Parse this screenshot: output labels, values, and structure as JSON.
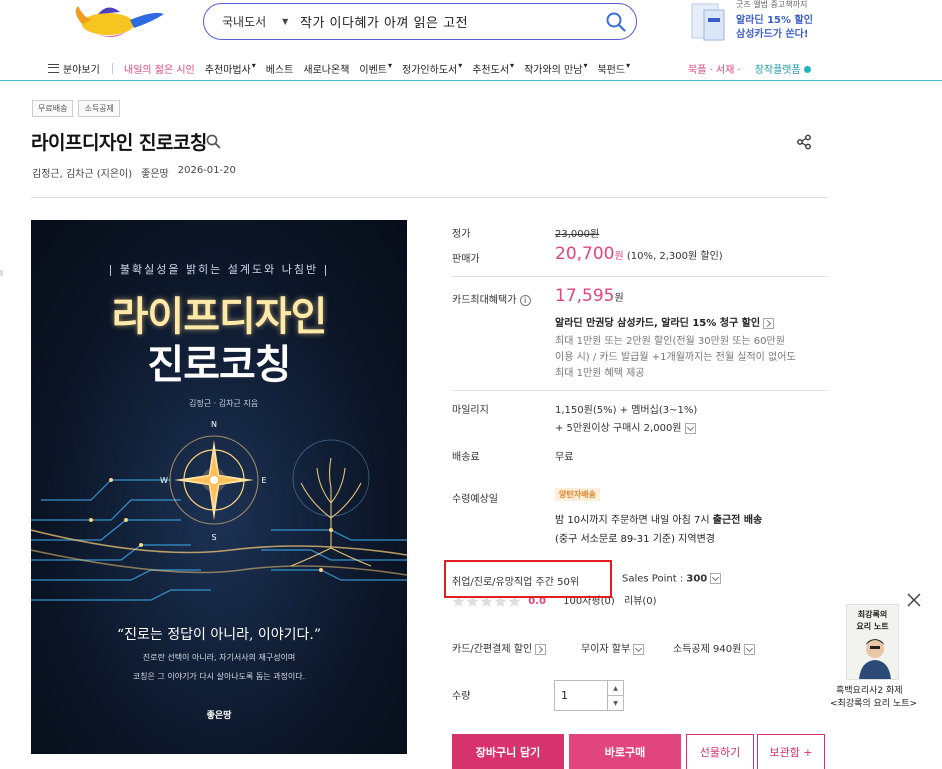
{
  "header": {
    "search": {
      "category": "국내도서",
      "query": "작가 이다혜가 아껴 읽은 고전"
    },
    "top_ad": {
      "line1": "굿즈 앨범 중고책까지",
      "line2": "알라딘 15% 할인",
      "line3": "삼성카드가 쏜다!"
    }
  },
  "gnb": {
    "menu_label": "분야보기",
    "items": [
      "내일의 젊은 시인",
      "추천마법사",
      "베스트",
      "새로나온책",
      "이벤트",
      "정가인하도서",
      "추천도서",
      "작가와의 만남",
      "북펀드"
    ],
    "items_with_arrow": [
      false,
      true,
      false,
      false,
      true,
      true,
      true,
      true,
      true
    ],
    "right": {
      "pink": "북플 · 서재 ·",
      "teal": "창작플랫폼"
    }
  },
  "product": {
    "badges": [
      "무료배송",
      "소득공제"
    ],
    "title": "라이프디자인 진로코칭",
    "authors": "김정근,  김차근 (지은이)",
    "publisher": "좋은땅",
    "date": "2026-01-20"
  },
  "cover": {
    "tagline": "| 불확실성을 밝히는 설계도와 나침반 |",
    "title1": "라이프디자인",
    "title2": "진로코칭",
    "author": "김정근 · 김차근 지음",
    "compass": {
      "n": "N",
      "e": "E",
      "s": "S",
      "w": "W"
    },
    "quote": "“진로는 정답이 아니라, 이야기다.”",
    "sub1": "진로란 선택이 아니라, 자기서사의 재구성이며",
    "sub2": "코칭은 그 이야기가 다시 살아나도록 돕는 과정이다.",
    "publisher": "좋은땅"
  },
  "info": {
    "list_price_label": "정가",
    "list_price": "23,000원",
    "sale_price_label": "판매가",
    "sale_price": "20,700",
    "sale_price_unit": "원",
    "sale_price_note": "(10%, 2,300원 할인)",
    "card_label": "카드최대혜택가",
    "card_price": "17,595",
    "card_price_unit": "원",
    "card_line1": "알라딘 만권당 삼성카드, 알라딘 15% 청구 할인",
    "card_line2": "최대 1만원 또는 2만원 할인(전월 30만원 또는 60만원",
    "card_line3": "이용 시) / 카드 발급월 +1개월까지는 전월 실적이 없어도",
    "card_line4": "최대 1만원 혜택 제공",
    "mileage_label": "마일리지",
    "mileage_line1": "1,150원(5%) + 멤버십(3~1%)",
    "mileage_line2": "+ 5만원이상 구매시 2,000원",
    "shipping_label": "배송료",
    "shipping_value": "무료",
    "delivery_label": "수령예상일",
    "delivery_badge": "양탄자배송",
    "delivery_line1_pre": "밤 10시까지 주문하면 내일 아침 7시 ",
    "delivery_line1_bold": "출근전 배송",
    "delivery_line2": "(중구 서소문로 89-31 기준) 지역변경",
    "rank": "취업/진로/유망직업 주간 50위",
    "sales_point_label": "Sales Point :",
    "sales_point": "300",
    "rating": "0.0",
    "review_count": "100자평(0)",
    "review_label": "리뷰(0)",
    "discount_label": "카드/간편결제 할인",
    "installment_label": "무이자 할부",
    "deduction_label": "소득공제 940원",
    "qty_label": "수량",
    "qty_value": "1",
    "buttons": {
      "cart": "장바구니 담기",
      "buy": "바로구매",
      "gift": "선물하기",
      "keep": "보관함 +"
    }
  },
  "side_ad": {
    "book_line1": "최강록의",
    "book_line2": "요리 노트",
    "caption1": "흑백요리사2 화제",
    "caption2": "<최강록의 요리 노트>"
  },
  "colors": {
    "accent_pink": "#e0457b",
    "search_border": "#5a5fd8",
    "gnb_line": "#49b6c4",
    "highlight": "#e02020"
  }
}
